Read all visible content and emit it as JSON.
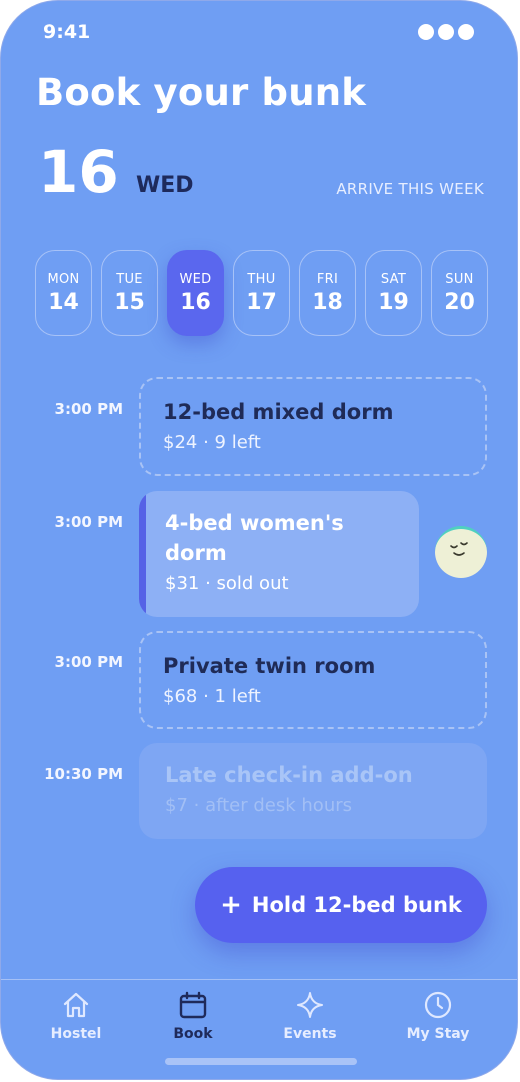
{
  "status": {
    "time": "9:41"
  },
  "header": {
    "title": "Book your bunk",
    "day_number": "16",
    "weekday": "WED",
    "subtitle": "ARRIVE THIS WEEK"
  },
  "days": [
    {
      "name": "MON",
      "num": "14",
      "selected": false
    },
    {
      "name": "TUE",
      "num": "15",
      "selected": false
    },
    {
      "name": "WED",
      "num": "16",
      "selected": true
    },
    {
      "name": "THU",
      "num": "17",
      "selected": false
    },
    {
      "name": "FRI",
      "num": "18",
      "selected": false
    },
    {
      "name": "SAT",
      "num": "19",
      "selected": false
    },
    {
      "name": "SUN",
      "num": "20",
      "selected": false
    }
  ],
  "slots": [
    {
      "time": "3:00 PM",
      "title": "12-bed mixed dorm",
      "detail": "$24 · 9 left",
      "state": "available"
    },
    {
      "time": "3:00 PM",
      "title_line1": "4-bed women's",
      "title_line2": "dorm",
      "detail": "$31 · sold out",
      "state": "sold-out"
    },
    {
      "time": "3:00 PM",
      "title": "Private twin room",
      "detail": "$68 · 1 left",
      "state": "available"
    },
    {
      "time": "10:30 PM",
      "title": "Late check-in add-on",
      "detail": "$7 · after desk hours",
      "state": "disabled"
    }
  ],
  "action": {
    "plus": "+",
    "label": "Hold 12-bed bunk"
  },
  "tabs": [
    {
      "label": "Hostel",
      "icon": "home-icon",
      "active": false
    },
    {
      "label": "Book",
      "icon": "calendar-icon",
      "active": true
    },
    {
      "label": "Events",
      "icon": "sparkle-icon",
      "active": false
    },
    {
      "label": "My Stay",
      "icon": "clock-icon",
      "active": false
    }
  ],
  "colors": {
    "background": "#6f9ef3",
    "accent": "#5661ef",
    "text_dark": "#1f2b57"
  }
}
